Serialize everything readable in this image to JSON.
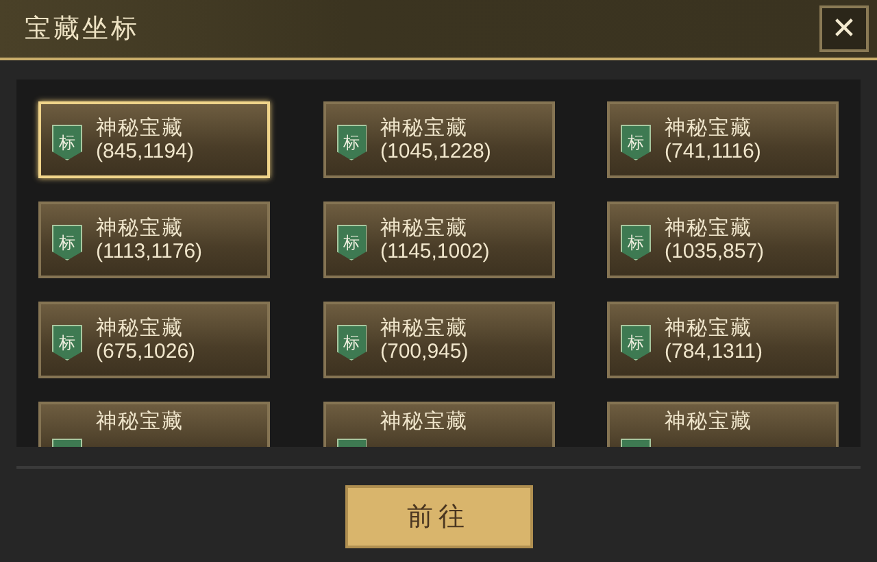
{
  "window": {
    "title": "宝藏坐标",
    "close": "✕"
  },
  "treasures": [
    {
      "badge": "标",
      "name": "神秘宝藏",
      "coords": "(845,1194)",
      "selected": true
    },
    {
      "badge": "标",
      "name": "神秘宝藏",
      "coords": "(1045,1228)",
      "selected": false
    },
    {
      "badge": "标",
      "name": "神秘宝藏",
      "coords": "(741,1116)",
      "selected": false
    },
    {
      "badge": "标",
      "name": "神秘宝藏",
      "coords": "(1113,1176)",
      "selected": false
    },
    {
      "badge": "标",
      "name": "神秘宝藏",
      "coords": "(1145,1002)",
      "selected": false
    },
    {
      "badge": "标",
      "name": "神秘宝藏",
      "coords": "(1035,857)",
      "selected": false
    },
    {
      "badge": "标",
      "name": "神秘宝藏",
      "coords": "(675,1026)",
      "selected": false
    },
    {
      "badge": "标",
      "name": "神秘宝藏",
      "coords": "(700,945)",
      "selected": false
    },
    {
      "badge": "标",
      "name": "神秘宝藏",
      "coords": "(784,1311)",
      "selected": false
    },
    {
      "name": "神秘宝藏",
      "selected": false
    },
    {
      "name": "神秘宝藏",
      "selected": false
    },
    {
      "name": "神秘宝藏",
      "selected": false
    }
  ],
  "go_button": "前往"
}
